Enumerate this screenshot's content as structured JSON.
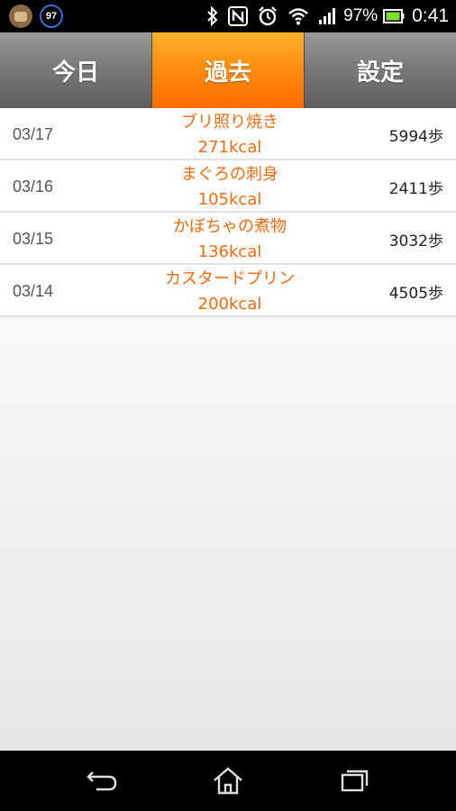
{
  "status_bar": {
    "badge_number": "97",
    "battery_percent": "97%",
    "time": "0:41"
  },
  "tabs": [
    {
      "label": "今日"
    },
    {
      "label": "過去"
    },
    {
      "label": "設定"
    }
  ],
  "active_tab": "過去",
  "colors": {
    "active_tab": "#ff8a10",
    "inactive_tab": "#7a7a7a",
    "meal_text": "#f26b10"
  },
  "history": [
    {
      "date": "03/17",
      "meal": "ブリ照り焼き",
      "kcal": "271kcal",
      "steps": "5994歩"
    },
    {
      "date": "03/16",
      "meal": "まぐろの刺身",
      "kcal": "105kcal",
      "steps": "2411歩"
    },
    {
      "date": "03/15",
      "meal": "かぼちゃの煮物",
      "kcal": "136kcal",
      "steps": "3032歩"
    },
    {
      "date": "03/14",
      "meal": "カスタードプリン",
      "kcal": "200kcal",
      "steps": "4505歩"
    }
  ],
  "nav": {
    "icons": [
      "back-icon",
      "home-icon",
      "recent-apps-icon"
    ]
  }
}
